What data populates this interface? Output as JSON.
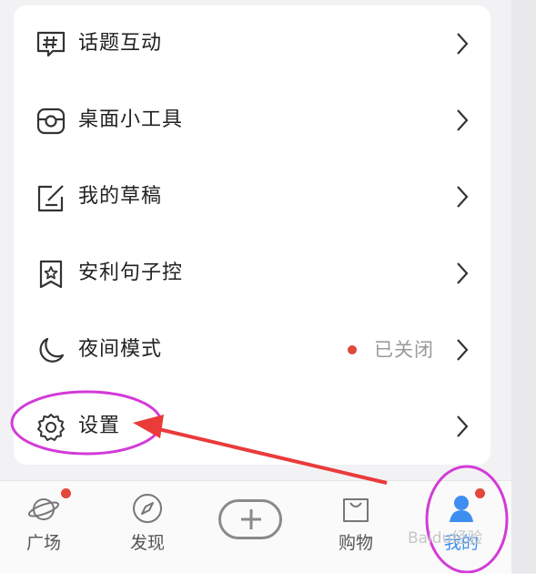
{
  "menu": {
    "items": [
      {
        "label": "话题互动",
        "icon": "hashtag-chat-icon"
      },
      {
        "label": "桌面小工具",
        "icon": "widget-icon"
      },
      {
        "label": "我的草稿",
        "icon": "edit-draft-icon"
      },
      {
        "label": "安利句子控",
        "icon": "bookmark-star-icon"
      },
      {
        "label": "夜间模式",
        "icon": "moon-icon",
        "status": "已关闭"
      },
      {
        "label": "设置",
        "icon": "gear-icon"
      }
    ]
  },
  "tabbar": {
    "tabs": [
      {
        "label": "广场",
        "icon": "planet-icon",
        "badge": true
      },
      {
        "label": "发现",
        "icon": "compass-icon",
        "badge": false
      },
      {
        "label": "",
        "icon": "plus-icon",
        "badge": false
      },
      {
        "label": "购物",
        "icon": "shopping-bag-icon",
        "badge": false
      },
      {
        "label": "我的",
        "icon": "profile-icon",
        "badge": true
      }
    ]
  },
  "watermark": "Baidu经验",
  "colors": {
    "badge": "#e0483c",
    "annotation": "#d23bd8",
    "arrow": "#ea3a3a",
    "accent_blue": "#3d8ef0",
    "text": "#222222",
    "muted": "#9a9a9a"
  }
}
